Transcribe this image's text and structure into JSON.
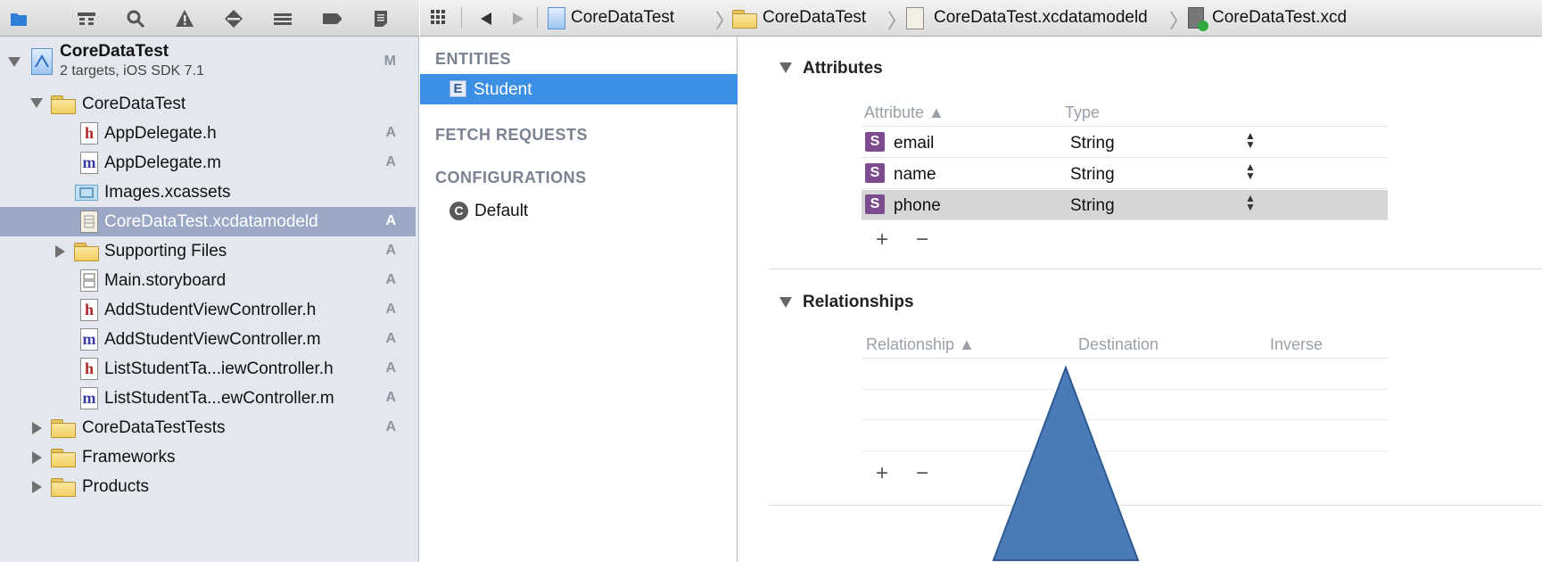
{
  "toolbar": {
    "nav_icons": [
      "project-navigator-icon",
      "symbol-navigator-icon",
      "search-navigator-icon",
      "issue-navigator-icon",
      "test-navigator-icon",
      "debug-navigator-icon",
      "breakpoint-navigator-icon",
      "log-navigator-icon"
    ]
  },
  "jumpbar": {
    "crumbs": [
      "CoreDataTest",
      "CoreDataTest",
      "CoreDataTest.xcdatamodeld",
      "CoreDataTest.xcd"
    ]
  },
  "navigator": {
    "project": {
      "name": "CoreDataTest",
      "subtitle": "2 targets, iOS SDK 7.1",
      "status": "M"
    },
    "items": [
      {
        "label": "CoreDataTest",
        "status": ""
      },
      {
        "label": "AppDelegate.h",
        "status": "A"
      },
      {
        "label": "AppDelegate.m",
        "status": "A"
      },
      {
        "label": "Images.xcassets",
        "status": ""
      },
      {
        "label": "CoreDataTest.xcdatamodeld",
        "status": "A"
      },
      {
        "label": "Supporting Files",
        "status": "A"
      },
      {
        "label": "Main.storyboard",
        "status": "A"
      },
      {
        "label": "AddStudentViewController.h",
        "status": "A"
      },
      {
        "label": "AddStudentViewController.m",
        "status": "A"
      },
      {
        "label": "ListStudentTa...iewController.h",
        "status": "A"
      },
      {
        "label": "ListStudentTa...ewController.m",
        "status": "A"
      },
      {
        "label": "CoreDataTestTests",
        "status": "A"
      },
      {
        "label": "Frameworks",
        "status": ""
      },
      {
        "label": "Products",
        "status": ""
      }
    ]
  },
  "entities_pane": {
    "entities_header": "ENTITIES",
    "entity": {
      "badge": "E",
      "label": "Student"
    },
    "fetch_header": "FETCH REQUESTS",
    "config_header": "CONFIGURATIONS",
    "configuration": {
      "badge": "C",
      "label": "Default"
    }
  },
  "editor": {
    "attributes": {
      "title": "Attributes",
      "col_attribute": "Attribute ▲",
      "col_type": "Type",
      "rows": [
        {
          "badge": "S",
          "name": "email",
          "type": "String"
        },
        {
          "badge": "S",
          "name": "name",
          "type": "String"
        },
        {
          "badge": "S",
          "name": "phone",
          "type": "String"
        }
      ],
      "add": "+",
      "remove": "−"
    },
    "relationships": {
      "title": "Relationships",
      "col_relationship": "Relationship ▲",
      "col_destination": "Destination",
      "col_inverse": "Inverse",
      "add": "+",
      "remove": "−"
    }
  },
  "colors": {
    "selection": "#9ba9c6",
    "entity_selection": "#3b8fe5",
    "triangle": "#4a7bb7",
    "attr_badge": "#7d4c8f"
  }
}
